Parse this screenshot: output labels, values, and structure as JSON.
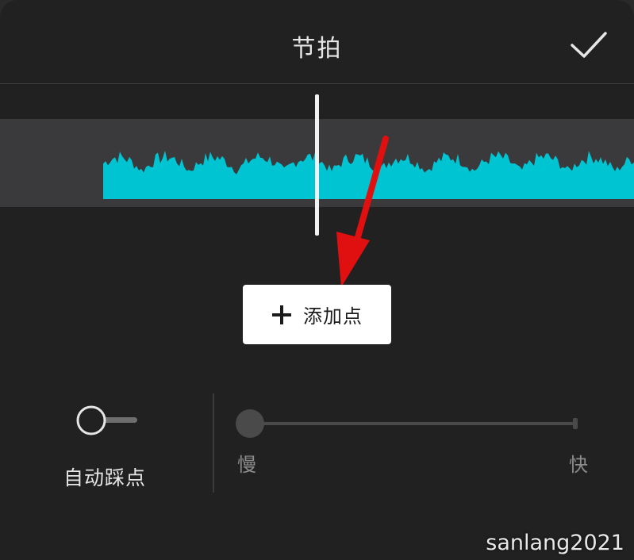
{
  "header": {
    "title": "节拍",
    "confirm_icon": "checkmark-icon"
  },
  "timeline": {
    "wave_color": "#00c4d2",
    "playhead_color": "#f2f2f2"
  },
  "add_point": {
    "label": "添加点",
    "icon": "plus-icon"
  },
  "auto_beat": {
    "label": "自动踩点",
    "enabled": false
  },
  "speed": {
    "slow_label": "慢",
    "fast_label": "快",
    "value": 0
  },
  "annotation": {
    "arrow_color": "#e01010"
  },
  "watermark": "sanlang2021"
}
